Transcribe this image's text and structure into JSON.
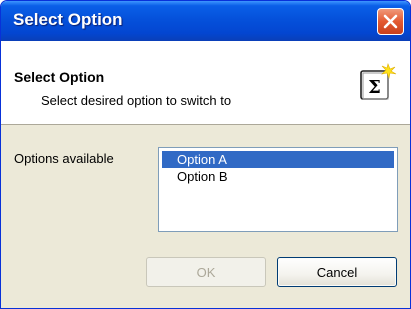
{
  "window": {
    "title": "Select Option",
    "title_bar_color": "#0551db",
    "close_icon": "close-icon"
  },
  "header": {
    "title": "Select Option",
    "subtitle": "Select desired option to switch to",
    "icon": "sigma-icon"
  },
  "options": {
    "label": "Options available",
    "items": [
      {
        "label": "Option A",
        "selected": true
      },
      {
        "label": "Option B",
        "selected": false
      }
    ],
    "selection_color": "#316ac5"
  },
  "buttons": {
    "ok_label": "OK",
    "ok_enabled": false,
    "cancel_label": "Cancel"
  }
}
